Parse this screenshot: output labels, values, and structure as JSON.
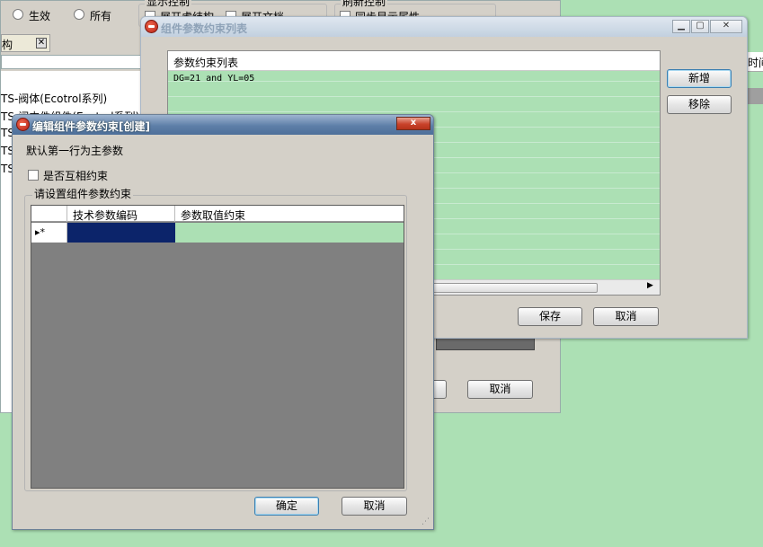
{
  "background_window": {
    "radio_active": "生效",
    "radio_all": "所有",
    "group_display": "显示控制",
    "check_expand_virtual": "展开虚结构",
    "check_expand_doc": "展开文档",
    "group_refresh": "刷新控制",
    "check_sync_props": "同步显示属性",
    "tree_tab": "构",
    "tree_items": [
      "TS-阀体(Ecotrol系列)",
      "TS-阀内件组件(Ecotrol系列)",
      "TS-",
      "TS-",
      "TS-"
    ],
    "right_col_header": "时间",
    "cancel_button": "取消",
    "ok_button_partial": "定"
  },
  "constraint_list_window": {
    "title": "组件参数约束列表",
    "list_header": "参数约束列表",
    "rows": [
      "DG=21 and YL=05"
    ],
    "add_button": "新增",
    "remove_button": "移除",
    "save_button": "保存",
    "cancel_button": "取消"
  },
  "edit_dialog": {
    "title": "编辑组件参数约束[创建]",
    "close_symbol": "x",
    "note": "默认第一行为主参数",
    "mutual_checkbox": "是否互相约束",
    "group_label": "请设置组件参数约束",
    "grid_columns": [
      "技术参数编码",
      "参数取值约束"
    ],
    "row_marker": "▸*",
    "ok_button": "确定",
    "cancel_button": "取消"
  },
  "colors": {
    "desktop_green": "#ace0b4",
    "row_green": "#ace0b4",
    "selected_cell": "#0c246a",
    "grid_empty": "#808080"
  }
}
